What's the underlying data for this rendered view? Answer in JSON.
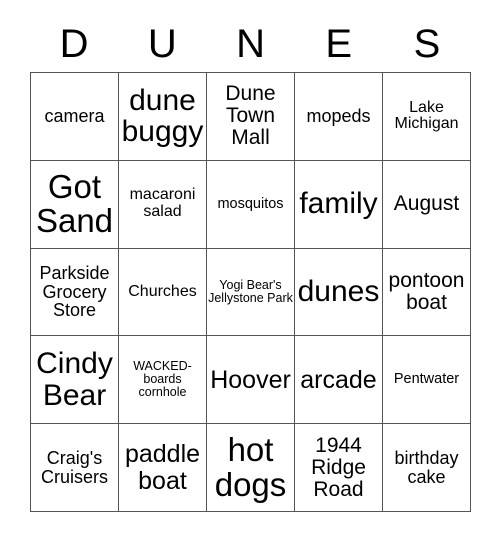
{
  "card": {
    "title_letters": [
      "D",
      "U",
      "N",
      "E",
      "S"
    ],
    "columns": 5,
    "rows": 5,
    "grid_line_color": "#555555",
    "text_color": "#000000",
    "background_color": "#ffffff",
    "cells": [
      [
        {
          "text": "camera",
          "size": "md"
        },
        {
          "text": "dune buggy",
          "size": "xxl"
        },
        {
          "text": "Dune Town Mall",
          "size": "lg"
        },
        {
          "text": "mopeds",
          "size": "md"
        },
        {
          "text": "Lake Michigan",
          "size": "smm"
        }
      ],
      [
        {
          "text": "Got Sand",
          "size": "hg"
        },
        {
          "text": "macaroni salad",
          "size": "smm"
        },
        {
          "text": "mosquitos",
          "size": "sm"
        },
        {
          "text": "family",
          "size": "xxl"
        },
        {
          "text": "August",
          "size": "lg"
        }
      ],
      [
        {
          "text": "Parkside Grocery Store",
          "size": "md"
        },
        {
          "text": "Churches",
          "size": "smm"
        },
        {
          "text": "Yogi Bear's Jellystone Park",
          "size": "xs"
        },
        {
          "text": "dunes",
          "size": "xxl"
        },
        {
          "text": "pontoon boat",
          "size": "lg"
        }
      ],
      [
        {
          "text": "Cindy Bear",
          "size": "xxl"
        },
        {
          "text": "WACKED-boards cornhole",
          "size": "xs"
        },
        {
          "text": "Hoover",
          "size": "xl"
        },
        {
          "text": "arcade",
          "size": "xl"
        },
        {
          "text": "Pentwater",
          "size": "sm"
        }
      ],
      [
        {
          "text": "Craig's Cruisers",
          "size": "md"
        },
        {
          "text": "paddle boat",
          "size": "xl"
        },
        {
          "text": "hot dogs",
          "size": "hg"
        },
        {
          "text": "1944 Ridge Road",
          "size": "lg"
        },
        {
          "text": "birthday cake",
          "size": "md"
        }
      ]
    ]
  }
}
